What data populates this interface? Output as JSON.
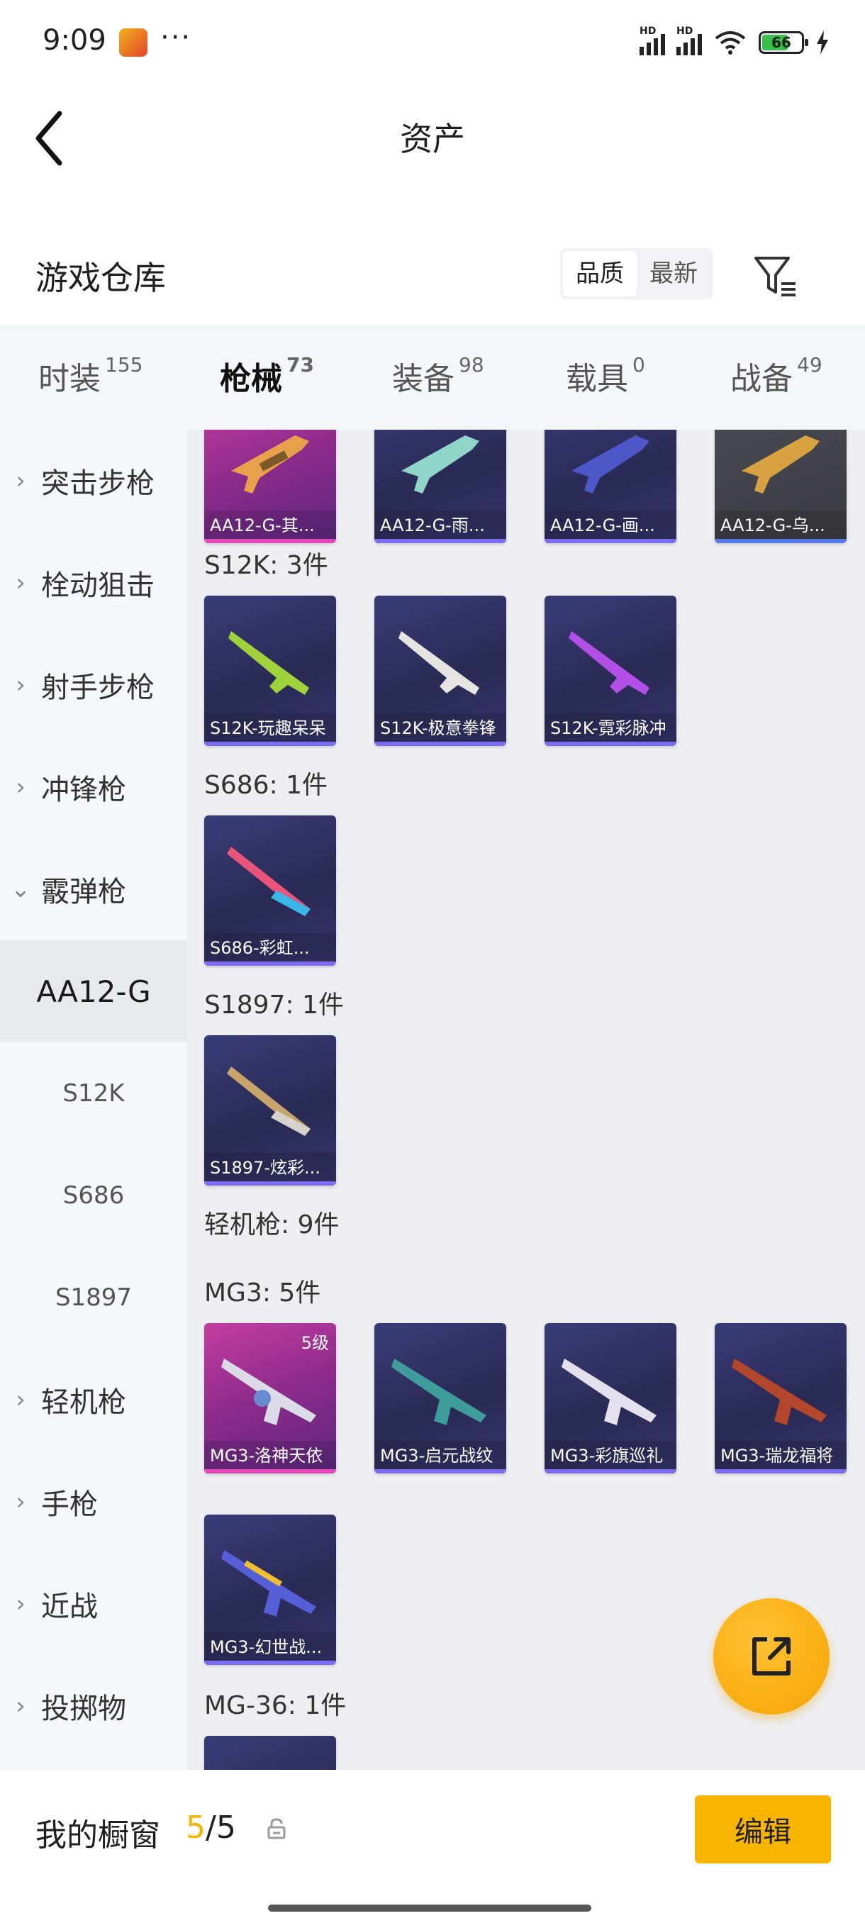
{
  "status_bar": {
    "time": "9:09",
    "more": "···",
    "battery": "66"
  },
  "header": {
    "title": "资产"
  },
  "warehouse": {
    "label": "游戏仓库",
    "sort_options": [
      "品质",
      "最新"
    ]
  },
  "tabs": [
    {
      "label": "时装",
      "count": "155"
    },
    {
      "label": "枪械",
      "count": "73"
    },
    {
      "label": "装备",
      "count": "98"
    },
    {
      "label": "载具",
      "count": "0"
    },
    {
      "label": "战备",
      "count": "49"
    }
  ],
  "sidebar": {
    "categories": [
      "突击步枪",
      "栓动狙击",
      "射手步枪",
      "冲锋枪",
      "霰弹枪",
      "轻机枪",
      "手枪",
      "近战",
      "投掷物"
    ],
    "subitems": [
      "AA12-G",
      "S12K",
      "S686",
      "S1897"
    ]
  },
  "content": {
    "row_top": [
      "AA12-G-其...",
      "AA12-G-雨...",
      "AA12-G-画...",
      "AA12-G-乌..."
    ],
    "s12k_header": "S12K: 3件",
    "s12k_items": [
      "S12K-玩趣呆呆",
      "S12K-极意拳锋",
      "S12K-霓彩脉冲"
    ],
    "s686_header": "S686: 1件",
    "s686_items": [
      "S686-彩虹..."
    ],
    "s1897_header": "S1897: 1件",
    "s1897_items": [
      "S1897-炫彩..."
    ],
    "lmg_header": "轻机枪: 9件",
    "mg3_header": "MG3: 5件",
    "mg3_items": [
      "MG3-洛神天依",
      "MG3-启元战纹",
      "MG3-彩旗巡礼",
      "MG3-瑞龙福将",
      "MG3-幻世战..."
    ],
    "mg3_level": "5级",
    "mg36_header": "MG-36: 1件"
  },
  "bottom": {
    "label": "我的橱窗",
    "current": "5",
    "sep_total": "/5",
    "edit_label": "编辑"
  },
  "colors": {
    "accent": "#f7b500",
    "purple_card": "#3a3c78",
    "pink_card": "#c23ea0"
  }
}
